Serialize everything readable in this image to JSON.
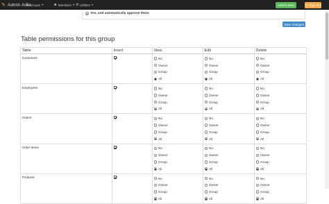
{
  "navbar": {
    "brand": "Admin Area",
    "menus": [
      {
        "label": "Groups",
        "icon": "groups-icon",
        "glyph": "☰"
      },
      {
        "label": "Members",
        "icon": "members-icon",
        "glyph": "☺"
      },
      {
        "label": "Utilities",
        "icon": "utilities-icon",
        "glyph": "⚙"
      }
    ],
    "users_area": "User's area",
    "sign_out": "Sign out"
  },
  "approve_option": "Yes, and automatically approve them.",
  "save_label": "Save changes",
  "section_title": "Table permissions for this group",
  "columns": [
    "Table",
    "Insert",
    "View",
    "Edit",
    "Delete"
  ],
  "options": [
    "No",
    "Owner",
    "Group",
    "All"
  ],
  "rows": [
    {
      "name": "Customers",
      "insert": true,
      "view": "All",
      "edit": "All",
      "delete": "All"
    },
    {
      "name": "Employees",
      "insert": true,
      "view": "All",
      "edit": "All",
      "delete": "All"
    },
    {
      "name": "Orders",
      "insert": true,
      "view": "All",
      "edit": "All",
      "delete": "All"
    },
    {
      "name": "Order Items",
      "insert": true,
      "view": "All",
      "edit": "All",
      "delete": "All"
    },
    {
      "name": "Products",
      "insert": true,
      "view": "All",
      "edit": "All",
      "delete": "All"
    }
  ],
  "colors": {
    "navbar": "#222222",
    "users_button": "#5cb85c",
    "signout_button": "#f0ad4e",
    "save_button": "#428bca"
  }
}
